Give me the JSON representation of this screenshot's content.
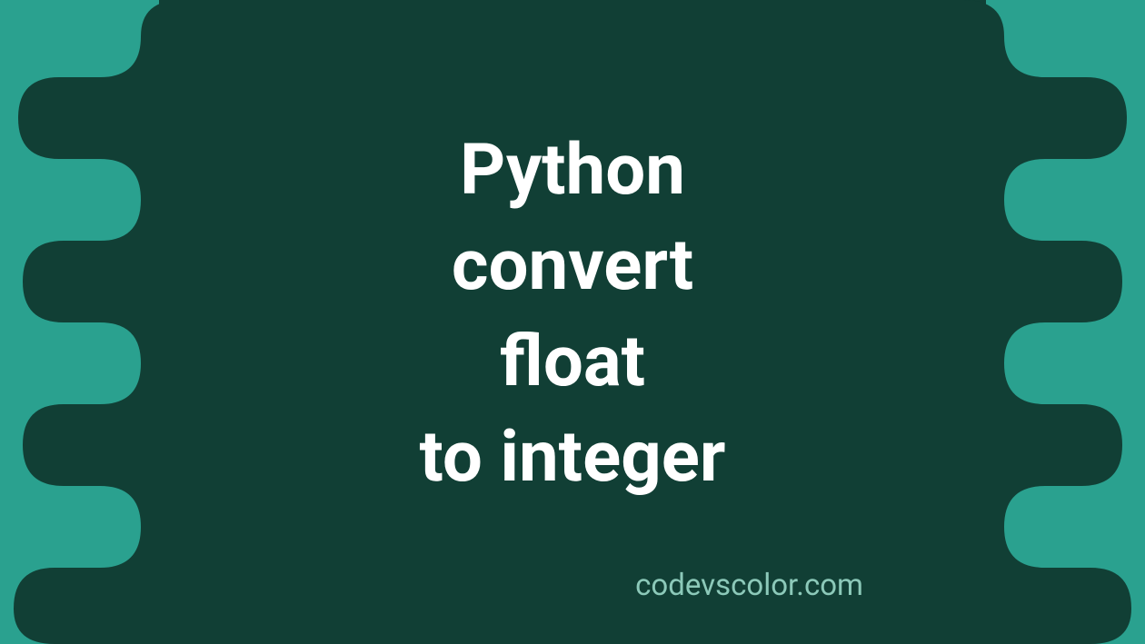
{
  "title": {
    "line1": "Python",
    "line2": "convert",
    "line3": "float",
    "line4": "to integer"
  },
  "brand": "codevscolor.com",
  "colors": {
    "background_teal": "#2aa18f",
    "dark_green": "#113f35",
    "text_white": "#ffffff",
    "brand_text": "#8cc9b9"
  }
}
